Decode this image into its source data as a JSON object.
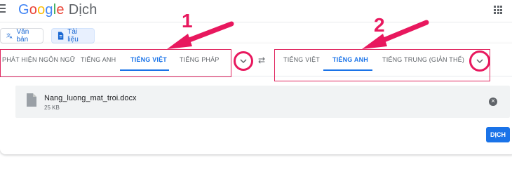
{
  "header": {
    "logo": "Google",
    "product": "Dịch"
  },
  "modes": {
    "text_label": "Văn bản",
    "docs_label": "Tài liệu"
  },
  "source_langs": [
    "PHÁT HIỆN NGÔN NGỮ",
    "TIẾNG ANH",
    "TIẾNG VIỆT",
    "TIẾNG PHÁP"
  ],
  "source_active_index": 2,
  "target_langs": [
    "TIẾNG VIỆT",
    "TIẾNG ANH",
    "TIẾNG TRUNG (GIẢN THỂ)"
  ],
  "target_active_index": 1,
  "swap_icon": "⇄",
  "annotations": {
    "arrow1_label": "1",
    "arrow2_label": "2",
    "accent": "#e8185e"
  },
  "document": {
    "name": "Nang_luong_mat_troi.docx",
    "size": "25 KB"
  },
  "translate_button": "DỊCH",
  "colors": {
    "accent_blue": "#1a73e8"
  }
}
